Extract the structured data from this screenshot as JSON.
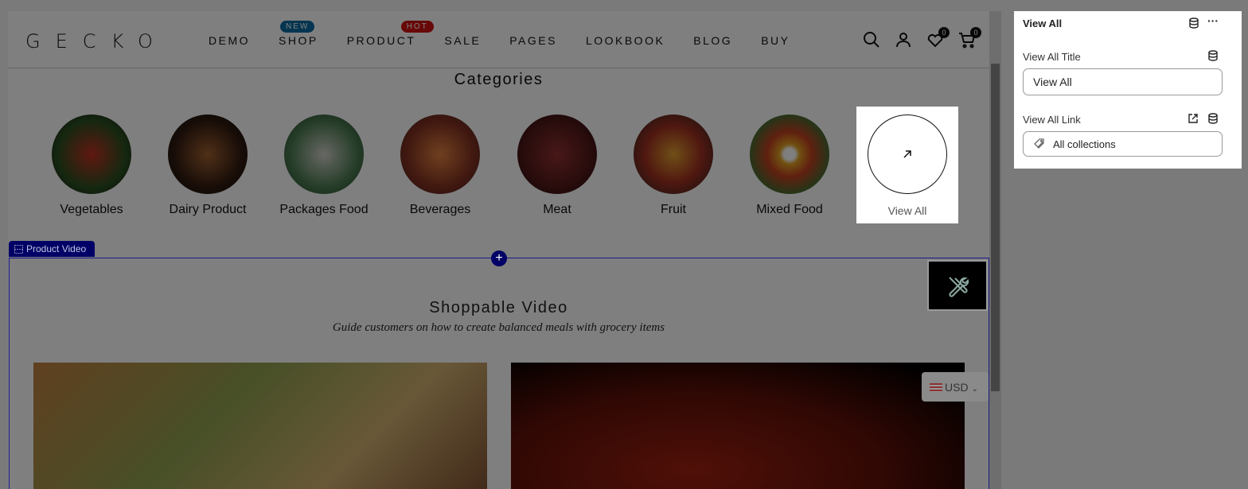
{
  "header": {
    "logo": "GECKO",
    "nav": [
      {
        "label": "DEMO"
      },
      {
        "label": "SHOP",
        "badge": "NEW",
        "badge_color": "#0a6aa0"
      },
      {
        "label": "PRODUCT",
        "badge": "HOT",
        "badge_color": "#d01010"
      },
      {
        "label": "SALE"
      },
      {
        "label": "PAGES"
      },
      {
        "label": "LOOKBOOK"
      },
      {
        "label": "BLOG"
      },
      {
        "label": "BUY"
      }
    ],
    "wishlist_count": "0",
    "cart_count": "0"
  },
  "categories": {
    "title": "Categories",
    "items": [
      {
        "label": "Vegetables"
      },
      {
        "label": "Dairy Product"
      },
      {
        "label": "Packages Food"
      },
      {
        "label": "Beverages"
      },
      {
        "label": "Meat"
      },
      {
        "label": "Fruit"
      },
      {
        "label": "Mixed Food"
      }
    ],
    "view_all": "View All"
  },
  "section": {
    "tag": "Product Video",
    "title": "Shoppable Video",
    "subtitle": "Guide customers on how to create balanced meals with grocery items"
  },
  "currency": "USD",
  "panel": {
    "title": "View All",
    "title_label": "View All Title",
    "title_value": "View All",
    "link_label": "View All Link",
    "link_value": "All collections"
  }
}
